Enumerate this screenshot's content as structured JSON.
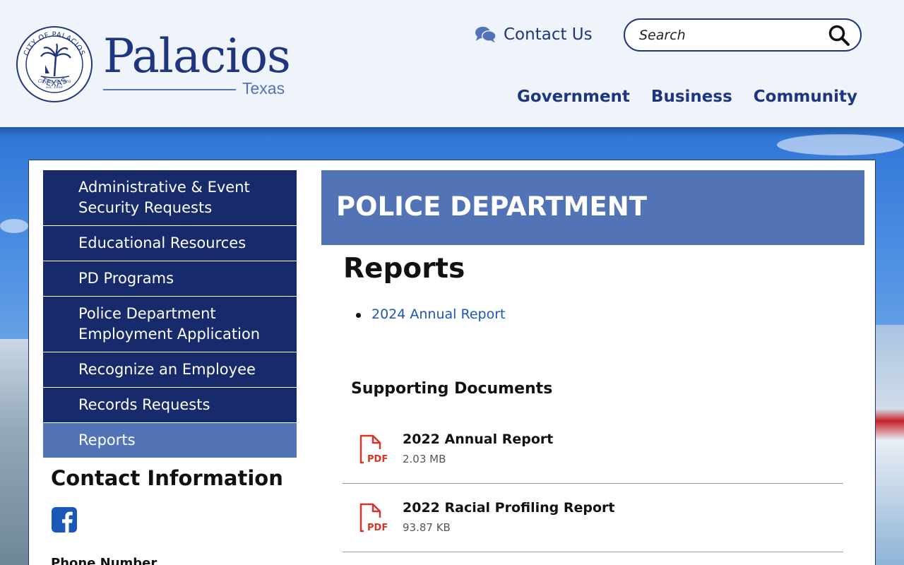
{
  "header": {
    "seal": {
      "top_text": "CITY OF PALACIOS",
      "bottom_text": "TEXAS",
      "motto": "City by the Sea",
      "est": "est. 1909"
    },
    "wordmark": {
      "name": "Palacios",
      "state": "Texas"
    },
    "contact_label": "Contact Us",
    "search": {
      "placeholder": "Search"
    },
    "nav": [
      "Government",
      "Business",
      "Community"
    ]
  },
  "sidebar": {
    "items": [
      {
        "label": "Administrative & Event Security Requests",
        "active": false
      },
      {
        "label": "Educational Resources",
        "active": false
      },
      {
        "label": "PD Programs",
        "active": false
      },
      {
        "label": "Police Department Employment Application",
        "active": false
      },
      {
        "label": "Recognize an Employee",
        "active": false
      },
      {
        "label": "Records Requests",
        "active": false
      },
      {
        "label": "Reports",
        "active": true
      }
    ],
    "contact_heading": "Contact Information",
    "phone_label": "Phone Number"
  },
  "main": {
    "department": "POLICE DEPARTMENT",
    "heading": "Reports",
    "links": [
      "2024 Annual Report"
    ],
    "docs_heading": "Supporting Documents",
    "documents": [
      {
        "title": "2022 Annual Report",
        "size": "2.03 MB",
        "type": "PDF"
      },
      {
        "title": "2022 Racial Profiling Report",
        "size": "93.87 KB",
        "type": "PDF"
      }
    ]
  },
  "colors": {
    "navy": "#1f3580",
    "sidebar_navy": "#172a6b",
    "accent_blue": "#5273b6",
    "link_blue": "#1a57b8",
    "pdf_red": "#d9342b",
    "header_bg": "#eef4fa"
  },
  "icons": {
    "contact": "chat-bubbles-icon",
    "search": "magnifier-icon",
    "social": "facebook-icon",
    "document": "pdf-file-icon"
  }
}
